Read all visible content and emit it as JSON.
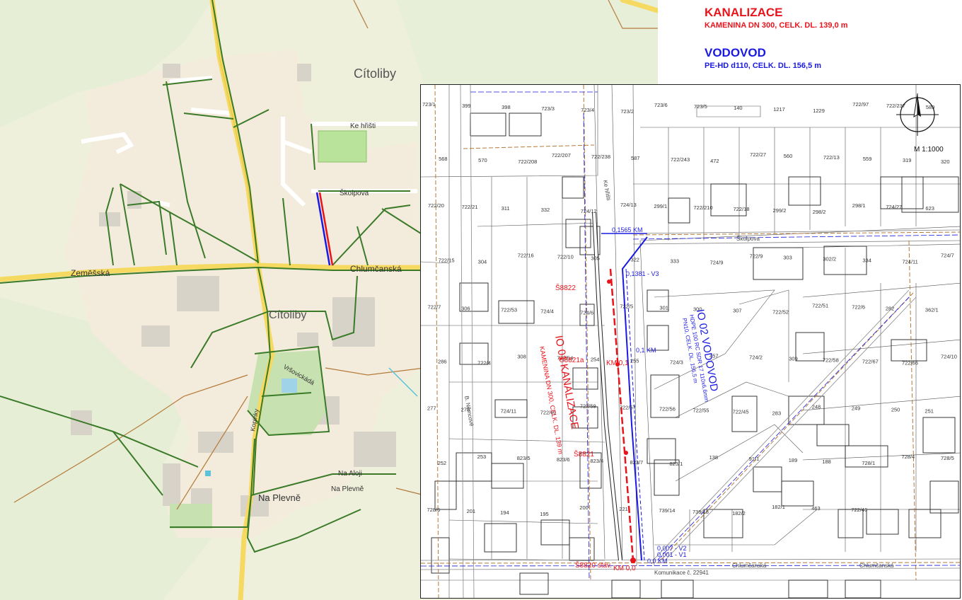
{
  "legend": {
    "sewer_title": "KANALIZACE",
    "sewer_spec": "KAMENINA DN 300, CELK. DL. 139,0 m",
    "water_title": "VODOVOD",
    "water_spec": "PE-HD d110, CELK. DL. 156,5  m"
  },
  "scale_label": "M 1:1000",
  "overview_map": {
    "town_labels": [
      "Cítoliby",
      "Cítoliby"
    ],
    "streets": [
      "Zeměšská",
      "Chlumčanská",
      "Ke hřišti",
      "Školpova",
      "Na Plevně",
      "Na Aloji",
      "Na Plevně",
      "Vršovickádá",
      "Kopinky"
    ],
    "colors": {
      "background": "#f1ecdc",
      "fields": "#e8eedb",
      "main_road": "#f5d960",
      "network": "#3a7a28",
      "sewer": "#e8141c",
      "water": "#1a1ae0"
    }
  },
  "detail_map": {
    "sewer_label": "IO 01 KANALIZACE",
    "sewer_sub": "KAMENINA DN 300, CELK. DL. 139 m",
    "water_label": "IO 02 VODOVOD",
    "water_sub_1": "HDPE 100 RC SDR 17 110x6,6mm",
    "water_sub_2": "PN10, CELK. DL. 156,5  m",
    "water_points": [
      "0,1565 KM",
      "0,1381 - V3",
      "0,1 KM",
      "0,007 - V2",
      "0,001 - V1",
      "0,0 KM"
    ],
    "sewer_points": [
      "Š8822",
      "Š8821a",
      "KM 0,1",
      "Š8821",
      "Š8820 stáv.",
      "KM 0,0"
    ],
    "streets": [
      "Školpova",
      "Chlumčanská",
      "Komunikace č. 22941",
      "Chlumčanská",
      "B. Němcové",
      "Ke hřišti"
    ],
    "parcels": [
      "723/1",
      "399",
      "398",
      "723/3",
      "723/4",
      "723/2",
      "723/6",
      "723/5",
      "140",
      "1217",
      "1229",
      "722/97",
      "722/237",
      "589",
      "568",
      "570",
      "722/208",
      "722/207",
      "722/238",
      "587",
      "722/243",
      "472",
      "722/27",
      "560",
      "722/13",
      "559",
      "319",
      "320",
      "722/20",
      "722/21",
      "311",
      "332",
      "724/12",
      "724/13",
      "299/1",
      "722/210",
      "722/18",
      "299/2",
      "298/2",
      "298/1",
      "724/27",
      "623",
      "722/15",
      "304",
      "722/16",
      "722/10",
      "305",
      "322",
      "333",
      "724/9",
      "722/9",
      "303",
      "302/2",
      "334",
      "724/11",
      "724/7",
      "722/7",
      "306",
      "722/53",
      "724/4",
      "724/6",
      "722/5",
      "301",
      "300",
      "307",
      "722/52",
      "722/51",
      "722/6",
      "282",
      "362/1",
      "286",
      "722/4",
      "308",
      "722/54",
      "254",
      "255",
      "724/3",
      "457",
      "724/2",
      "309",
      "722/58",
      "722/67",
      "722/66",
      "724/10",
      "277",
      "278",
      "724/11",
      "722/61",
      "722/59",
      "722/57",
      "722/56",
      "722/55",
      "722/45",
      "283",
      "248",
      "249",
      "250",
      "251",
      "252",
      "253",
      "823/5",
      "823/6",
      "823/4",
      "823/7",
      "823/1",
      "138",
      "91/1",
      "189",
      "188",
      "728/1",
      "728/4",
      "728/5",
      "728/6",
      "201",
      "194",
      "195",
      "200",
      "221",
      "739/14",
      "739/18",
      "182/2",
      "182/1",
      "463",
      "722/46"
    ]
  }
}
